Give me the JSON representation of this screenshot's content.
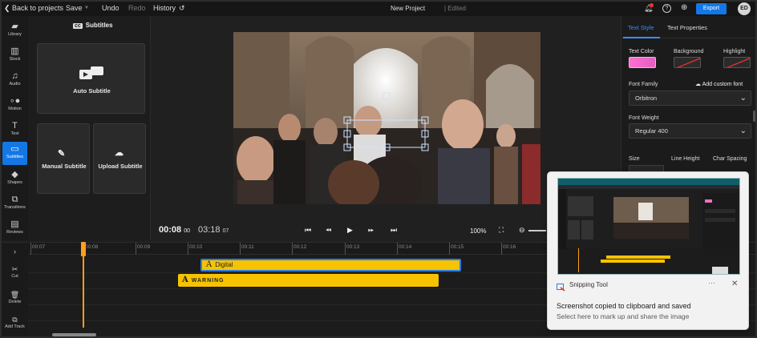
{
  "colors": {
    "accent": "#1477e6",
    "clip": "#f7c300",
    "playhead": "#ff9f1a",
    "text_color_swatch": "#f070c0"
  },
  "topbar": {
    "back": "Back to projects",
    "save": "Save",
    "undo": "Undo",
    "redo": "Redo",
    "history": "History",
    "project_name": "New Project",
    "edited": "| Edited",
    "export": "Export",
    "avatar": "ED",
    "icons": [
      "bell-icon",
      "help-icon",
      "globe-icon"
    ]
  },
  "sidebar": {
    "items": [
      {
        "label": "Library",
        "icon": "folder-icon"
      },
      {
        "label": "Stock",
        "icon": "books-icon"
      },
      {
        "label": "Audio",
        "icon": "music-icon"
      },
      {
        "label": "Motion",
        "icon": "motion-icon"
      },
      {
        "label": "Text",
        "icon": "text-icon"
      },
      {
        "label": "Subtitles",
        "icon": "subtitles-icon"
      },
      {
        "label": "Shapes",
        "icon": "shapes-icon"
      },
      {
        "label": "Transitions",
        "icon": "transitions-icon"
      },
      {
        "label": "Reviews",
        "icon": "reviews-icon"
      }
    ],
    "active": "Subtitles"
  },
  "subtitles_panel": {
    "title": "Subtitles",
    "auto": "Auto Subtitle",
    "manual": "Manual Subtitle",
    "upload": "Upload Subtitle"
  },
  "player": {
    "current_time": "00:08",
    "current_frames": "00",
    "total_time": "03:18",
    "total_frames": "07",
    "zoom": "100%"
  },
  "right_panel": {
    "tabs": [
      "Text Style",
      "Text Properties"
    ],
    "active_tab": "Text Style",
    "text_color": "Text Color",
    "background": "Background",
    "highlight": "Highlight",
    "font_family_label": "Font Family",
    "add_custom_font": "Add custom font",
    "font_family": "Orbitron",
    "font_weight_label": "Font Weight",
    "font_weight": "Regular 400",
    "size": "Size",
    "line_height": "Line Height",
    "char_spacing": "Char Spacing"
  },
  "timeline": {
    "ticks": [
      "00:07",
      "00:08",
      "00:09",
      "00:10",
      "00:11",
      "00:12",
      "00:13",
      "00:14",
      "00:15",
      "00:16"
    ],
    "tools": [
      "Cut",
      "Delete",
      "Add Track"
    ],
    "clips": [
      {
        "label": "Digital"
      },
      {
        "label": "WARNING"
      }
    ]
  },
  "toast": {
    "app": "Snipping Tool",
    "line1": "Screenshot copied to clipboard and saved",
    "line2": "Select here to mark up and share the image"
  }
}
